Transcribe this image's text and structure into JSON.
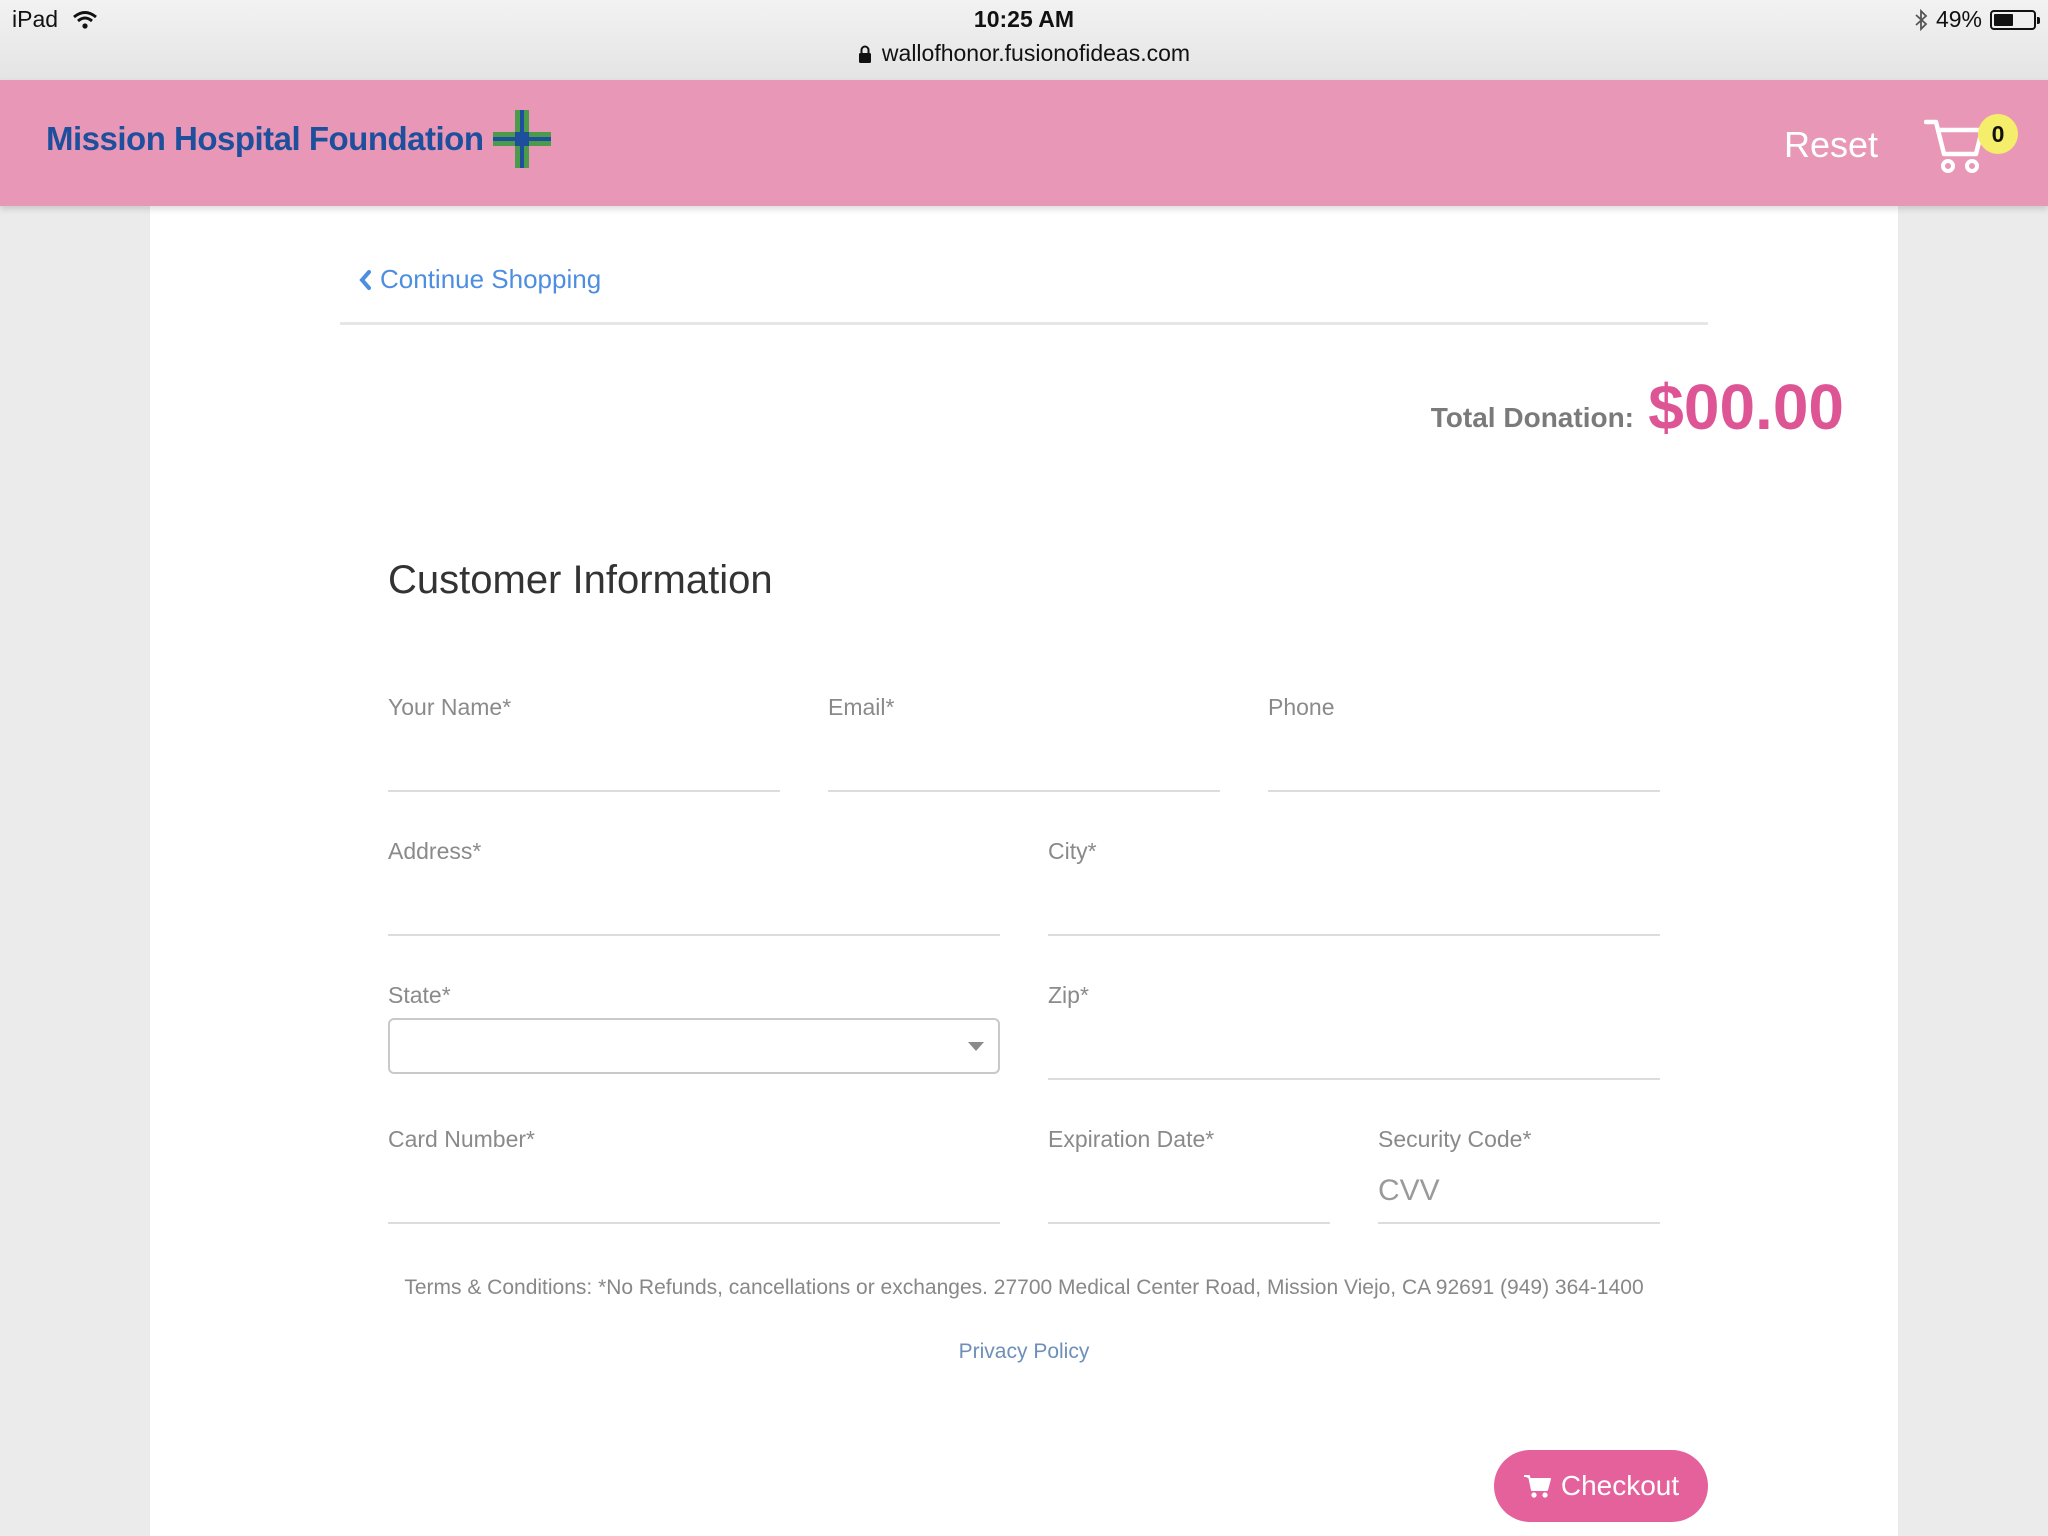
{
  "status_bar": {
    "device": "iPad",
    "time": "10:25 AM",
    "url": "wallofhonor.fusionofideas.com",
    "battery": "49%",
    "battery_level": 0.49
  },
  "header": {
    "logo_text": "Mission Hospital Foundation",
    "reset_label": "Reset",
    "cart_count": "0",
    "brand_color": "#e897b6"
  },
  "nav": {
    "continue_label": "Continue Shopping"
  },
  "summary": {
    "total_label": "Total Donation:",
    "total_amount": "$00.00"
  },
  "form": {
    "title": "Customer Information",
    "name_label": "Your Name*",
    "email_label": "Email*",
    "phone_label": "Phone",
    "address_label": "Address*",
    "city_label": "City*",
    "state_label": "State*",
    "state_value": "",
    "zip_label": "Zip*",
    "card_label": "Card Number*",
    "expiration_label": "Expiration Date*",
    "security_label": "Security Code*",
    "security_placeholder": "CVV"
  },
  "footer": {
    "terms_text": "Terms & Conditions: *No Refunds, cancellations or exchanges. 27700 Medical Center Road, Mission Viejo, CA 92691      (949) 364-1400",
    "privacy_label": "Privacy Policy",
    "checkout_label": "Checkout",
    "accent_color": "#e5619c"
  }
}
